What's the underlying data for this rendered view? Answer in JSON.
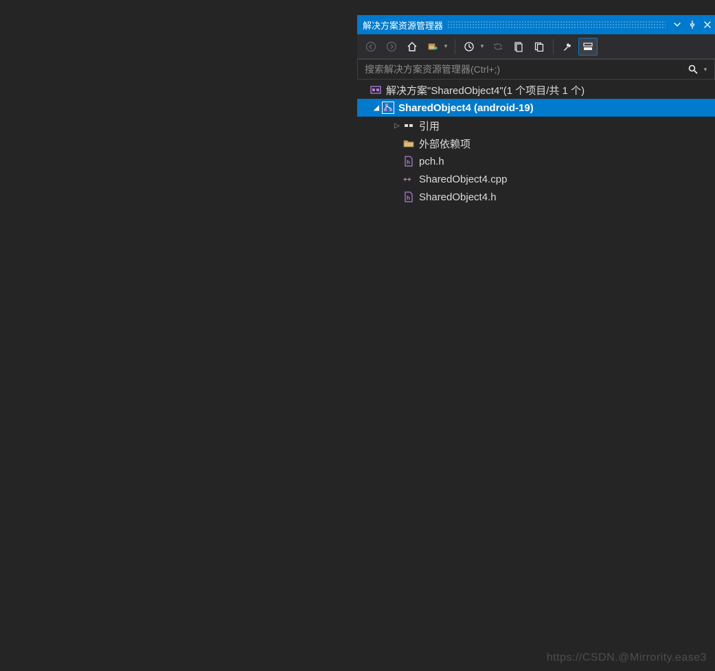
{
  "panel": {
    "title": "解决方案资源管理器"
  },
  "search": {
    "placeholder": "搜索解决方案资源管理器(Ctrl+;)"
  },
  "tree": {
    "solution": "解决方案\"SharedObject4\"(1 个项目/共 1 个)",
    "project": "SharedObject4 (android-19)",
    "references": "引用",
    "external_deps": "外部依赖项",
    "file_pch": "pch.h",
    "file_cpp": "SharedObject4.cpp",
    "file_h": "SharedObject4.h"
  },
  "watermark": "https://CSDN.@Mirrority.ease3"
}
